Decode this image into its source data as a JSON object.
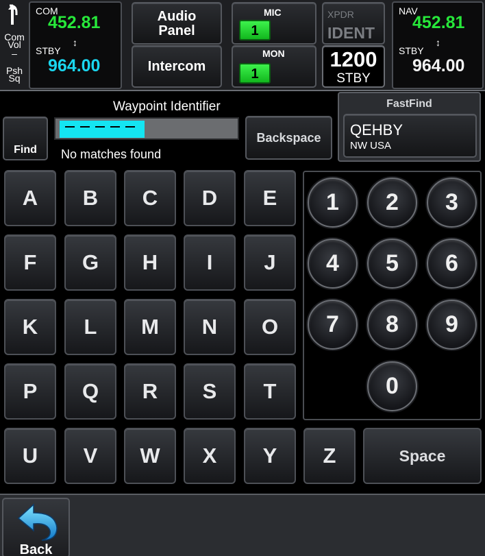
{
  "topbar": {
    "com_vol": [
      "Com",
      "Vol",
      "–",
      "Psh",
      "Sq"
    ],
    "com": {
      "label": "COM",
      "active": "452.81",
      "stby_label": "STBY",
      "standby": "964.00"
    },
    "audio_panel": [
      "Audio",
      "Panel"
    ],
    "intercom": "Intercom",
    "mic": {
      "label": "MIC",
      "value": "1"
    },
    "mon": {
      "label": "MON",
      "value": "1"
    },
    "xpdr": {
      "label": "XPDR",
      "ident": "IDENT",
      "code": "1200",
      "mode": "STBY"
    },
    "nav": {
      "label": "NAV",
      "active": "452.81",
      "stby_label": "STBY",
      "standby": "964.00"
    },
    "swap_glyph": "↕"
  },
  "entry": {
    "title": "Waypoint Identifier",
    "find": "Find",
    "status": "No matches found",
    "backspace": "Backspace"
  },
  "fastfind": {
    "title": "FastFind",
    "identifier": "QEHBY",
    "region": "NW USA"
  },
  "keyboard": {
    "letters": [
      "A",
      "B",
      "C",
      "D",
      "E",
      "F",
      "G",
      "H",
      "I",
      "J",
      "K",
      "L",
      "M",
      "N",
      "O",
      "P",
      "Q",
      "R",
      "S",
      "T",
      "U",
      "V",
      "W",
      "X",
      "Y",
      "Z"
    ],
    "space": "Space",
    "digits": [
      "1",
      "2",
      "3",
      "4",
      "5",
      "6",
      "7",
      "8",
      "9",
      "0"
    ]
  },
  "bottom": {
    "back": "Back"
  },
  "colors": {
    "active_freq": "#27e73a",
    "standby_freq": "#1ad6ef",
    "cursor": "#14e5f2"
  }
}
